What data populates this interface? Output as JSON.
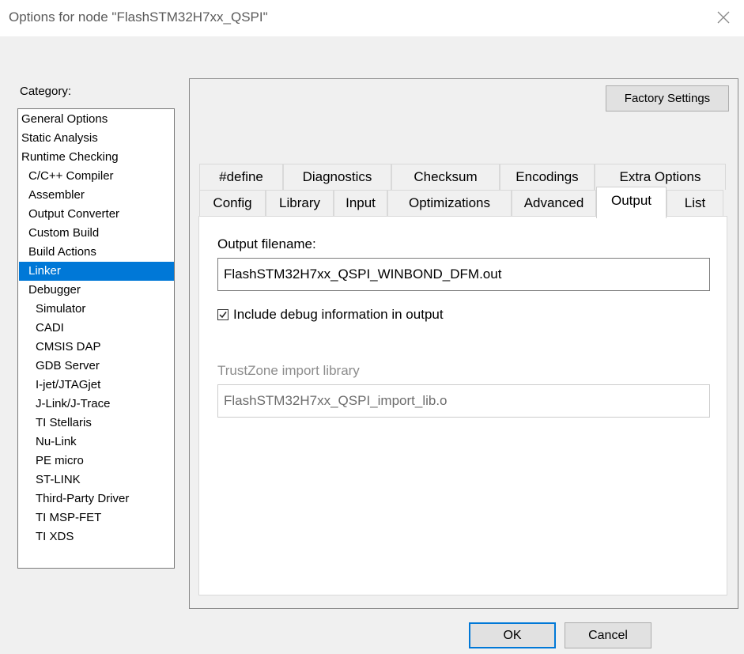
{
  "window": {
    "title": "Options for node \"FlashSTM32H7xx_QSPI\""
  },
  "category": {
    "label": "Category:",
    "items": [
      {
        "label": "General Options"
      },
      {
        "label": "Static Analysis"
      },
      {
        "label": "Runtime Checking"
      },
      {
        "label": "C/C++ Compiler"
      },
      {
        "label": "Assembler"
      },
      {
        "label": "Output Converter"
      },
      {
        "label": "Custom Build"
      },
      {
        "label": "Build Actions"
      },
      {
        "label": "Linker",
        "selected": true
      },
      {
        "label": "Debugger"
      },
      {
        "label": "Simulator"
      },
      {
        "label": "CADI"
      },
      {
        "label": "CMSIS DAP"
      },
      {
        "label": "GDB Server"
      },
      {
        "label": "I-jet/JTAGjet"
      },
      {
        "label": "J-Link/J-Trace"
      },
      {
        "label": "TI Stellaris"
      },
      {
        "label": "Nu-Link"
      },
      {
        "label": "PE micro"
      },
      {
        "label": "ST-LINK"
      },
      {
        "label": "Third-Party Driver"
      },
      {
        "label": "TI MSP-FET"
      },
      {
        "label": "TI XDS"
      }
    ]
  },
  "factory_settings_label": "Factory Settings",
  "tabs": {
    "row1": [
      "#define",
      "Diagnostics",
      "Checksum",
      "Encodings",
      "Extra Options"
    ],
    "row2": [
      "Config",
      "Library",
      "Input",
      "Optimizations",
      "Advanced",
      "Output",
      "List"
    ],
    "active": "Output"
  },
  "output": {
    "filename_label": "Output filename:",
    "filename_value": "FlashSTM32H7xx_QSPI_WINBOND_DFM.out",
    "include_debug_label": "Include debug information in output",
    "include_debug_checked": true,
    "trustzone_label": "TrustZone import library",
    "trustzone_value": "FlashSTM32H7xx_QSPI_import_lib.o",
    "trustzone_enabled": false
  },
  "buttons": {
    "ok": "OK",
    "cancel": "Cancel"
  },
  "colors": {
    "selection": "#0078d7",
    "dialog_bg": "#f0f0f0",
    "disabled_text": "#8c8c8c"
  }
}
